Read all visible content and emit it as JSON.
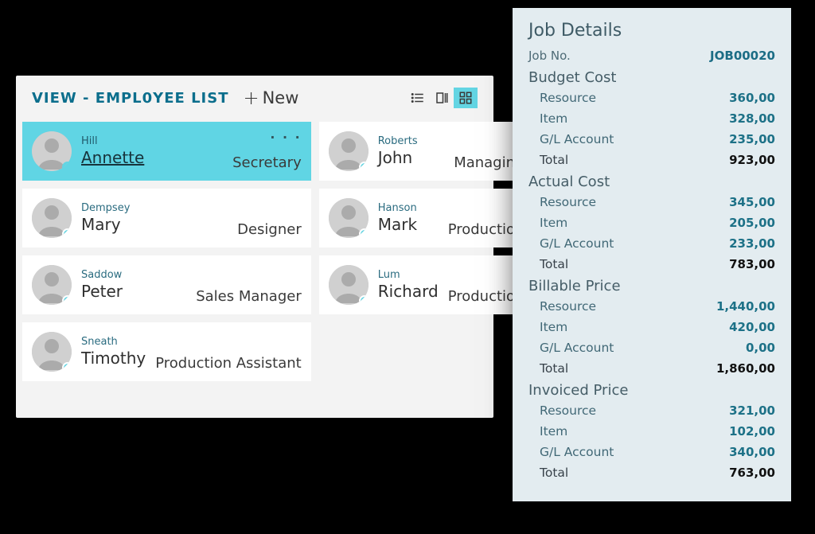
{
  "list": {
    "title": "VIEW - EMPL0YEE LIST",
    "new_label": "New",
    "employees": [
      {
        "last": "Hill",
        "first": "Annette",
        "role": "Secretary",
        "selected": true,
        "more": true
      },
      {
        "last": "Roberts",
        "first": "John",
        "role": "Managing",
        "selected": false,
        "more": false
      },
      {
        "last": "Dempsey",
        "first": "Mary",
        "role": "Designer",
        "selected": false,
        "more": false
      },
      {
        "last": "Hanson",
        "first": "Mark",
        "role": "Production",
        "selected": false,
        "more": false
      },
      {
        "last": "Saddow",
        "first": "Peter",
        "role": "Sales Manager",
        "selected": false,
        "more": false
      },
      {
        "last": "Lum",
        "first": "Richard",
        "role": "Production",
        "selected": false,
        "more": false
      },
      {
        "last": "Sneath",
        "first": "Timothy",
        "role": "Production Assistant",
        "selected": false,
        "more": false
      }
    ]
  },
  "details": {
    "title": "Job Details",
    "jobno_label": "Job No.",
    "jobno": "JOB00020",
    "sections": [
      {
        "label": "Budget Cost",
        "rows": [
          {
            "k": "Resource",
            "v": "360,00"
          },
          {
            "k": "Item",
            "v": "328,00"
          },
          {
            "k": "G/L Account",
            "v": "235,00"
          }
        ],
        "total_label": "Total",
        "total": "923,00"
      },
      {
        "label": "Actual Cost",
        "rows": [
          {
            "k": "Resource",
            "v": "345,00"
          },
          {
            "k": "Item",
            "v": "205,00"
          },
          {
            "k": "G/L Account",
            "v": "233,00"
          }
        ],
        "total_label": "Total",
        "total": "783,00"
      },
      {
        "label": "Billable Price",
        "rows": [
          {
            "k": "Resource",
            "v": "1,440,00"
          },
          {
            "k": "Item",
            "v": "420,00"
          },
          {
            "k": "G/L Account",
            "v": "0,00"
          }
        ],
        "total_label": "Total",
        "total": "1,860,00"
      },
      {
        "label": "Invoiced Price",
        "rows": [
          {
            "k": "Resource",
            "v": "321,00"
          },
          {
            "k": "Item",
            "v": "102,00"
          },
          {
            "k": "G/L Account",
            "v": "340,00"
          }
        ],
        "total_label": "Total",
        "total": "763,00"
      }
    ]
  }
}
